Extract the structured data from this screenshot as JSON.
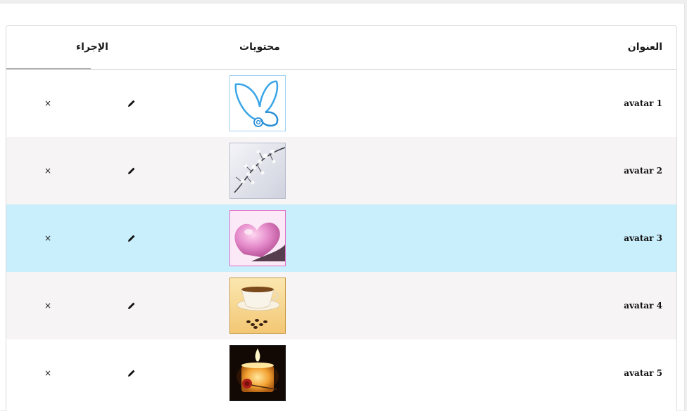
{
  "table": {
    "headers": {
      "title": "العنوان",
      "contents": "محتويات",
      "action": "الإجراء"
    },
    "rows": [
      {
        "title": "avatar 1",
        "image": "butterfly-logo",
        "delete_glyph": "×",
        "state": "normal"
      },
      {
        "title": "avatar 2",
        "image": "snowy-branch",
        "delete_glyph": "×",
        "state": "normal"
      },
      {
        "title": "avatar 3",
        "image": "pink-heart",
        "delete_glyph": "×",
        "state": "selected"
      },
      {
        "title": "avatar 4",
        "image": "coffee-cup",
        "delete_glyph": "×",
        "state": "normal"
      },
      {
        "title": "avatar 5",
        "image": "candle-with-rose",
        "delete_glyph": "×",
        "state": "normal"
      }
    ]
  },
  "icons": {
    "edit": "pencil-icon",
    "delete": "close-icon"
  },
  "colors": {
    "selected_row": "#c9eefc",
    "striped_row": "#f6f4f5"
  }
}
